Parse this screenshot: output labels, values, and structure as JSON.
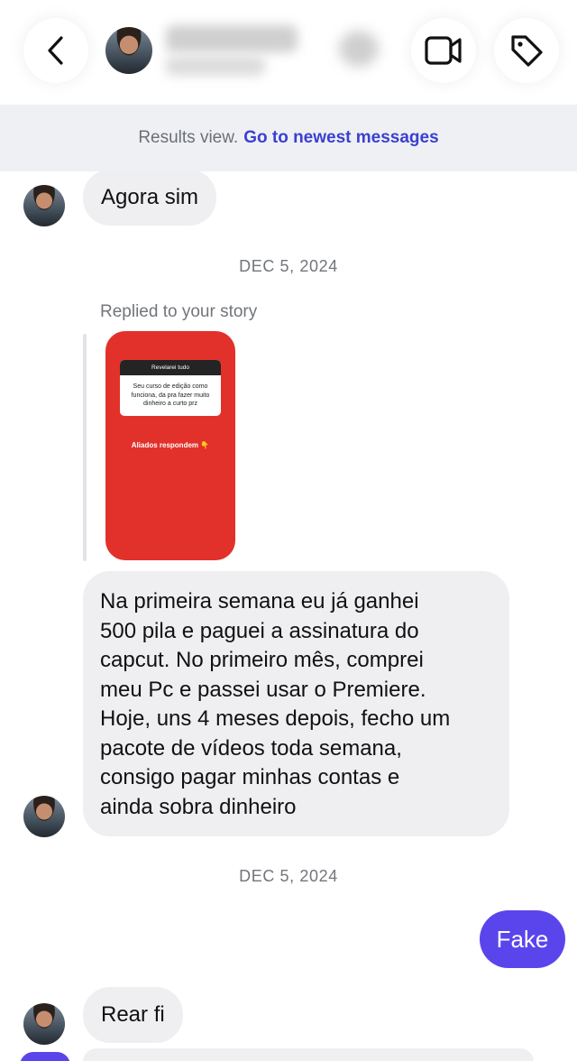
{
  "header": {
    "back_icon": "chevron-left-icon",
    "video_icon": "video-camera-icon",
    "tag_icon": "tag-icon"
  },
  "banner": {
    "results_text": "Results view.",
    "newest_link": "Go to newest messages"
  },
  "messages": {
    "first": "Agora sim",
    "date_1": "DEC 5, 2024",
    "reply_label": "Replied to your story",
    "story": {
      "card_title": "Revelarei tudo",
      "card_text": "Seu curso de edição como funciona, da pra fazer muito dinheiro a curto prz",
      "caption": "Aliados respondem 👇",
      "background": "#e2312a"
    },
    "long_lines": [
      "Na primeira semana eu já ganhei",
      "500 pila e paguei a assinatura do",
      "capcut. No primeiro mês, comprei",
      "meu Pc e passei usar o Premiere.",
      "Hoje, uns 4 meses depois, fecho um",
      "pacote de vídeos toda semana,",
      "consigo pagar minhas contas e",
      "ainda sobra dinheiro"
    ],
    "date_2": "DEC 5, 2024",
    "own_reply": "Fake",
    "last": "Rear fi"
  },
  "colors": {
    "accent": "#5a45ec",
    "link": "#3b3fd1",
    "bubble_gray": "#efeff2",
    "banner_bg": "#eef0f3"
  }
}
